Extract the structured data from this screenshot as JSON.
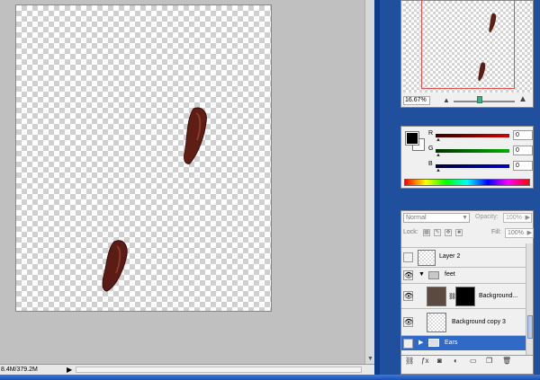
{
  "document": {
    "status_info": "8.4M/379.2M"
  },
  "navigator": {
    "zoom": "16.67%"
  },
  "color_panel": {
    "channels": [
      {
        "label": "R",
        "value": "0",
        "color": "#d00000"
      },
      {
        "label": "G",
        "value": "0",
        "color": "#00b000"
      },
      {
        "label": "B",
        "value": "0",
        "color": "#0000c0"
      }
    ],
    "foreground": "#000000",
    "background": "#ffffff"
  },
  "layers_panel": {
    "blend_mode": "Normal",
    "opacity_label": "Opacity:",
    "opacity": "100%",
    "lock_label": "Lock:",
    "fill_label": "Fill:",
    "fill": "100%",
    "layers": [
      {
        "name": "Layer 2",
        "visible": false,
        "type": "layer"
      },
      {
        "name": "feet",
        "visible": true,
        "type": "group",
        "expanded": true
      },
      {
        "name": "Background...",
        "visible": true,
        "type": "layer-with-mask"
      },
      {
        "name": "Background copy 3",
        "visible": true,
        "type": "layer"
      },
      {
        "name": "Ears",
        "visible": false,
        "type": "group",
        "selected": true
      }
    ]
  },
  "colors": {
    "accent": "#3169c6",
    "taskbar": "#1d4fb3",
    "desktop": "#1f4f9d"
  }
}
